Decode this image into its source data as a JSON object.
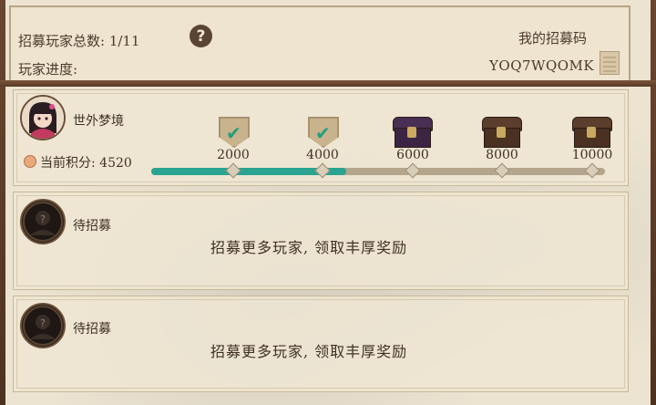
{
  "header": {
    "total_label": "招募玩家总数: 1/11",
    "progress_label": "玩家进度:",
    "my_code_label": "我的招募码",
    "code_value": "YOQ7WQOMK",
    "help_icon": "question-mark-icon",
    "copy_icon": "copy-icon"
  },
  "player": {
    "name": "世外梦境",
    "points_label": "当前积分: 4520",
    "points_value": 4520
  },
  "milestones": [
    {
      "value": "2000",
      "reward": "claimed-shield-icon"
    },
    {
      "value": "4000",
      "reward": "claimed-shield-icon"
    },
    {
      "value": "6000",
      "reward": "purple-chest-icon"
    },
    {
      "value": "8000",
      "reward": "brown-chest-icon"
    },
    {
      "value": "10000",
      "reward": "brown-chest-icon"
    }
  ],
  "slots": [
    {
      "name": "待招募",
      "message": "招募更多玩家, 领取丰厚奖励"
    },
    {
      "name": "待招募",
      "message": "招募更多玩家, 领取丰厚奖励"
    }
  ],
  "colors": {
    "progress_fill": "#2aa391",
    "panel": "#ece3d1"
  }
}
